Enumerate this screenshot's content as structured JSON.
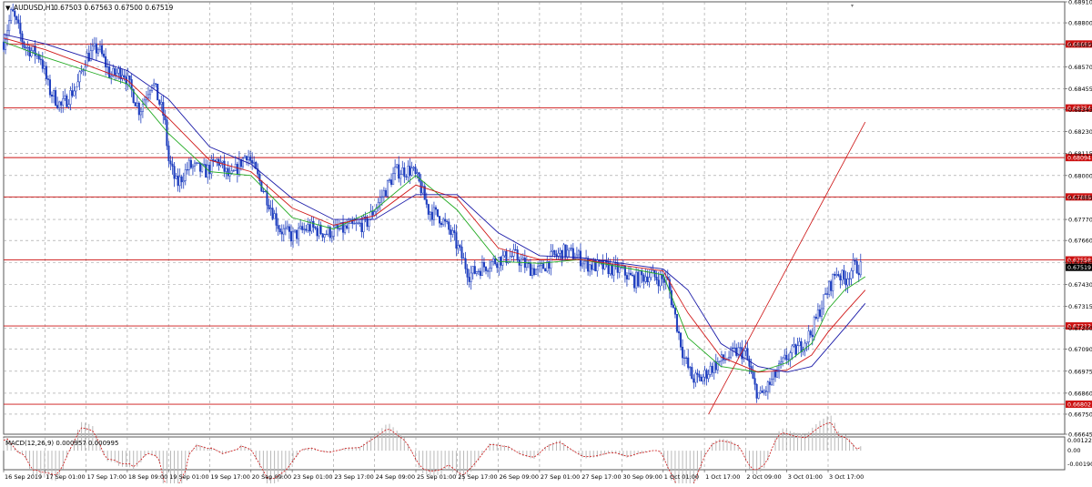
{
  "header": {
    "symbol_label": "AUDUSD,H1",
    "ohlc_label": "0.67503 0.67563 0.67500 0.67519"
  },
  "macd": {
    "label": "MACD(12,26,9) 0.000957 0.000995",
    "ticks": [
      "0.001221",
      "0.00",
      "-0.00190"
    ],
    "ylim": [
      -0.0019,
      0.001221
    ]
  },
  "colors": {
    "candles": "#1f3fbf",
    "ma_fast": "#22aa22",
    "ma_mid": "#d01818",
    "ma_slow": "#1a1aa8",
    "level_line": "#cc1111",
    "trend_line": "#cc1111",
    "last_price_badge": "#000000",
    "macd_hist": "#b8b8b8",
    "macd_signal": "#cc1111"
  },
  "chart_data": {
    "type": "candlestick",
    "ylim": [
      0.66645,
      0.6891
    ],
    "y_ticks": [
      "0.68910",
      "0.68800",
      "0.68685",
      "0.68570",
      "0.68455",
      "0.68345",
      "0.68230",
      "0.68115",
      "0.68000",
      "0.67885",
      "0.67770",
      "0.67660",
      "0.67545",
      "0.67430",
      "0.67315",
      "0.67200",
      "0.67090",
      "0.66975",
      "0.66860",
      "0.66750",
      "0.66645"
    ],
    "x_labels": [
      "16 Sep 2019",
      "17 Sep 01:00",
      "17 Sep 17:00",
      "18 Sep 09:00",
      "19 Sep 01:00",
      "19 Sep 17:00",
      "20 Sep 09:00",
      "23 Sep 01:00",
      "23 Sep 17:00",
      "24 Sep 09:00",
      "25 Sep 01:00",
      "25 Sep 17:00",
      "26 Sep 09:00",
      "27 Sep 01:00",
      "27 Sep 17:00",
      "30 Sep 09:00",
      "1 Oct 01:00",
      "1 Oct 17:00",
      "2 Oct 09:00",
      "3 Oct 01:00",
      "3 Oct 17:00"
    ],
    "horizontal_levels": [
      {
        "value": 0.68689,
        "label": "0.68689"
      },
      {
        "value": 0.68354,
        "label": "0.68354"
      },
      {
        "value": 0.68094,
        "label": "0.68094"
      },
      {
        "value": 0.67888,
        "label": "0.67888"
      },
      {
        "value": 0.67558,
        "label": "0.67558"
      },
      {
        "value": 0.67212,
        "label": "0.67212"
      },
      {
        "value": 0.66802,
        "label": "0.66802"
      }
    ],
    "last_price": {
      "value": 0.67519,
      "label": "0.67519"
    },
    "trend_line": {
      "from": {
        "x": 17.1,
        "y": 0.6675
      },
      "to": {
        "x": 20.9,
        "y": 0.6828
      }
    },
    "price_path": [
      [
        0.0,
        0.687
      ],
      [
        0.2,
        0.6886
      ],
      [
        0.5,
        0.6868
      ],
      [
        0.9,
        0.6862
      ],
      [
        1.1,
        0.6845
      ],
      [
        1.4,
        0.6836
      ],
      [
        1.8,
        0.6848
      ],
      [
        2.0,
        0.6862
      ],
      [
        2.3,
        0.6867
      ],
      [
        2.6,
        0.6852
      ],
      [
        2.9,
        0.6855
      ],
      [
        3.3,
        0.6834
      ],
      [
        3.6,
        0.685
      ],
      [
        3.9,
        0.683
      ],
      [
        4.0,
        0.6808
      ],
      [
        4.2,
        0.6795
      ],
      [
        4.5,
        0.6805
      ],
      [
        4.9,
        0.6802
      ],
      [
        5.2,
        0.6808
      ],
      [
        5.5,
        0.6798
      ],
      [
        5.9,
        0.6812
      ],
      [
        6.1,
        0.6802
      ],
      [
        6.4,
        0.6788
      ],
      [
        6.7,
        0.6772
      ],
      [
        7.0,
        0.6768
      ],
      [
        7.4,
        0.6773
      ],
      [
        7.8,
        0.677
      ],
      [
        8.3,
        0.6772
      ],
      [
        8.8,
        0.6775
      ],
      [
        9.2,
        0.679
      ],
      [
        9.5,
        0.6802
      ],
      [
        9.9,
        0.6803
      ],
      [
        10.1,
        0.6795
      ],
      [
        10.3,
        0.6782
      ],
      [
        10.6,
        0.6778
      ],
      [
        10.9,
        0.6768
      ],
      [
        11.1,
        0.6758
      ],
      [
        11.3,
        0.6748
      ],
      [
        11.6,
        0.6752
      ],
      [
        12.0,
        0.6756
      ],
      [
        12.4,
        0.6758
      ],
      [
        12.7,
        0.6752
      ],
      [
        13.0,
        0.675
      ],
      [
        13.3,
        0.6757
      ],
      [
        13.6,
        0.676
      ],
      [
        13.9,
        0.6758
      ],
      [
        14.2,
        0.6753
      ],
      [
        14.6,
        0.6752
      ],
      [
        15.0,
        0.675
      ],
      [
        15.3,
        0.6745
      ],
      [
        15.6,
        0.6748
      ],
      [
        15.9,
        0.6746
      ],
      [
        16.1,
        0.6745
      ],
      [
        16.3,
        0.6725
      ],
      [
        16.5,
        0.6705
      ],
      [
        16.7,
        0.6694
      ],
      [
        16.9,
        0.6693
      ],
      [
        17.2,
        0.67
      ],
      [
        17.5,
        0.6704
      ],
      [
        17.8,
        0.6708
      ],
      [
        18.0,
        0.6707
      ],
      [
        18.2,
        0.669
      ],
      [
        18.35,
        0.6684
      ],
      [
        18.5,
        0.6688
      ],
      [
        18.8,
        0.6698
      ],
      [
        19.0,
        0.6705
      ],
      [
        19.3,
        0.671
      ],
      [
        19.6,
        0.6718
      ],
      [
        19.8,
        0.673
      ],
      [
        20.0,
        0.674
      ],
      [
        20.2,
        0.675
      ],
      [
        20.4,
        0.6745
      ],
      [
        20.6,
        0.6752
      ],
      [
        20.8,
        0.67519
      ]
    ],
    "series": [
      {
        "kind": "ma_fast",
        "values": [
          [
            0,
            0.687
          ],
          [
            1,
            0.6862
          ],
          [
            2,
            0.6855
          ],
          [
            3,
            0.6848
          ],
          [
            4,
            0.6822
          ],
          [
            5,
            0.6802
          ],
          [
            6,
            0.68
          ],
          [
            7,
            0.6778
          ],
          [
            8,
            0.6772
          ],
          [
            9,
            0.6782
          ],
          [
            10,
            0.68
          ],
          [
            11,
            0.6782
          ],
          [
            12,
            0.6755
          ],
          [
            13,
            0.6754
          ],
          [
            14,
            0.6756
          ],
          [
            15,
            0.6752
          ],
          [
            16,
            0.6748
          ],
          [
            16.6,
            0.6715
          ],
          [
            17.4,
            0.67
          ],
          [
            18.3,
            0.6697
          ],
          [
            19,
            0.6702
          ],
          [
            19.6,
            0.6712
          ],
          [
            20,
            0.673
          ],
          [
            20.4,
            0.674
          ],
          [
            20.9,
            0.6747
          ]
        ]
      },
      {
        "kind": "ma_mid",
        "values": [
          [
            0,
            0.6872
          ],
          [
            1,
            0.6866
          ],
          [
            2,
            0.6858
          ],
          [
            3,
            0.685
          ],
          [
            4,
            0.683
          ],
          [
            5,
            0.6808
          ],
          [
            6,
            0.6802
          ],
          [
            7,
            0.6783
          ],
          [
            8,
            0.6774
          ],
          [
            9,
            0.6779
          ],
          [
            10,
            0.6795
          ],
          [
            11,
            0.6788
          ],
          [
            12,
            0.6762
          ],
          [
            13,
            0.6756
          ],
          [
            14,
            0.6756
          ],
          [
            15,
            0.6753
          ],
          [
            16,
            0.675
          ],
          [
            16.6,
            0.6728
          ],
          [
            17.4,
            0.6705
          ],
          [
            18.3,
            0.6697
          ],
          [
            19,
            0.6698
          ],
          [
            19.6,
            0.6706
          ],
          [
            20,
            0.6718
          ],
          [
            20.4,
            0.6728
          ],
          [
            20.9,
            0.674
          ]
        ]
      },
      {
        "kind": "ma_slow",
        "values": [
          [
            0,
            0.6874
          ],
          [
            1,
            0.6869
          ],
          [
            2,
            0.6862
          ],
          [
            3,
            0.6855
          ],
          [
            4,
            0.684
          ],
          [
            5,
            0.6815
          ],
          [
            6,
            0.6806
          ],
          [
            7,
            0.6788
          ],
          [
            8,
            0.6777
          ],
          [
            9,
            0.6777
          ],
          [
            10,
            0.679
          ],
          [
            11,
            0.679
          ],
          [
            12,
            0.677
          ],
          [
            13,
            0.6758
          ],
          [
            14,
            0.6757
          ],
          [
            15,
            0.6754
          ],
          [
            16,
            0.6751
          ],
          [
            16.6,
            0.674
          ],
          [
            17.4,
            0.6712
          ],
          [
            18.3,
            0.67
          ],
          [
            19,
            0.6697
          ],
          [
            19.6,
            0.67
          ],
          [
            20,
            0.671
          ],
          [
            20.4,
            0.672
          ],
          [
            20.9,
            0.6733
          ]
        ]
      }
    ]
  }
}
